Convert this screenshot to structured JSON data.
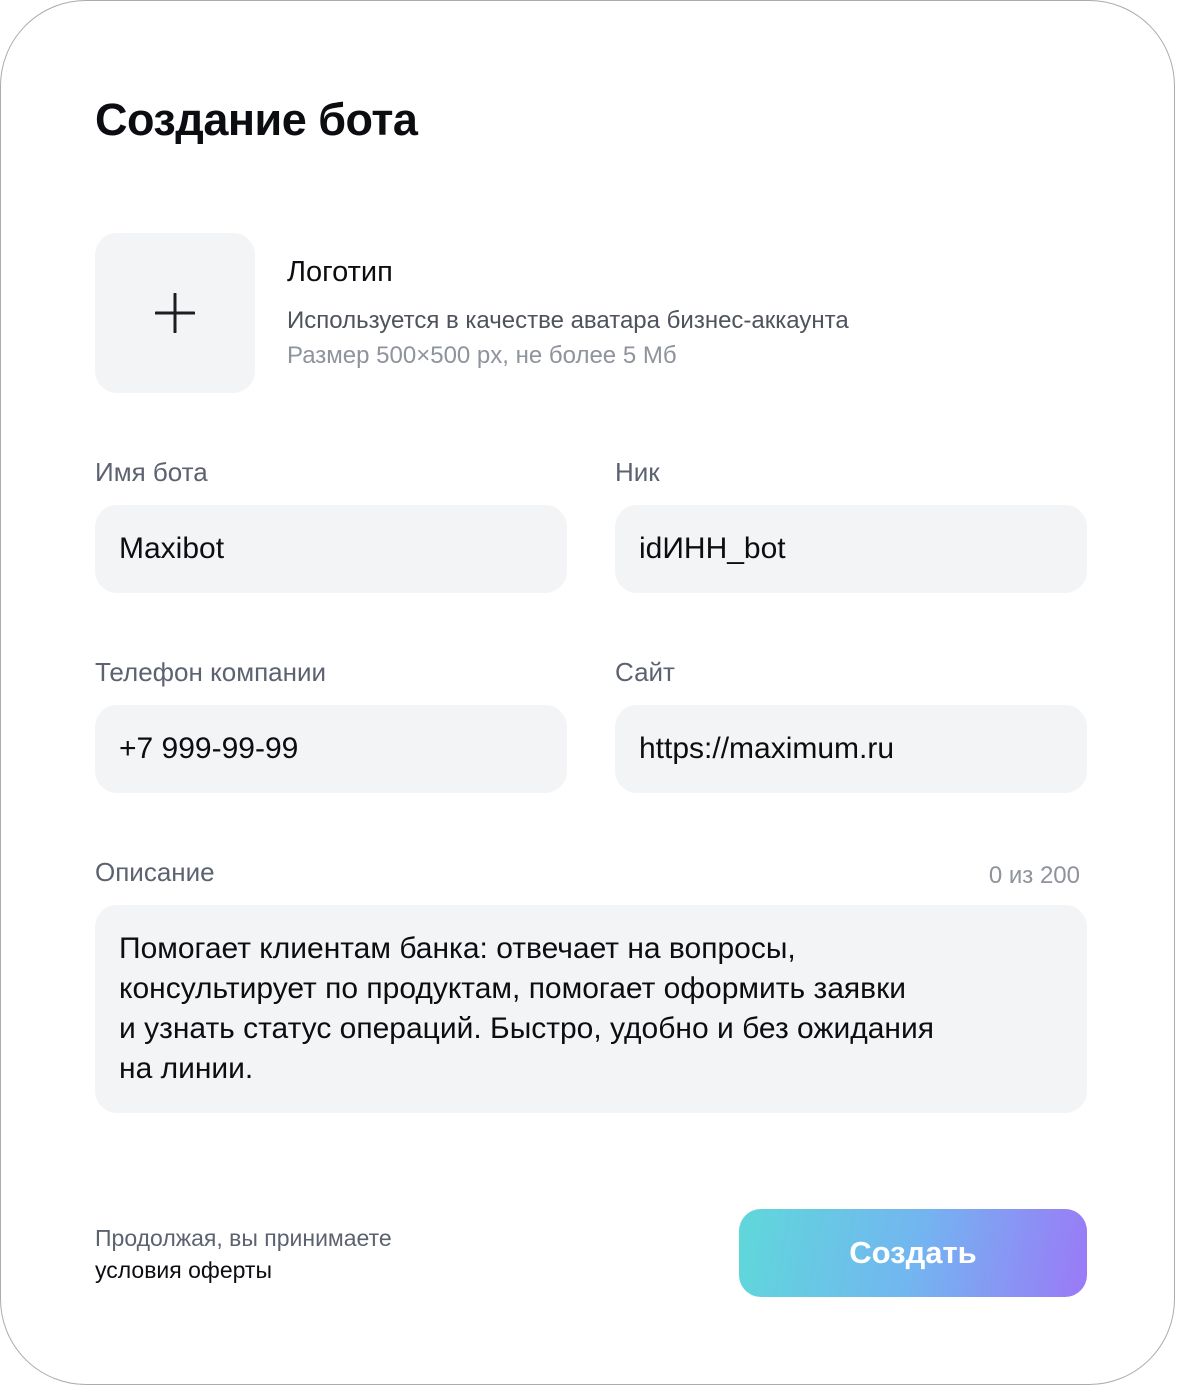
{
  "dialog": {
    "title": "Создание бота"
  },
  "logo": {
    "title": "Логотип",
    "description": "Используется в качестве аватара бизнес-аккаунта",
    "hint": "Размер 500×500 px, не более 5 Мб",
    "icon": "plus-icon"
  },
  "fields": {
    "bot_name": {
      "label": "Имя бота",
      "value": "Maxibot"
    },
    "nick": {
      "label": "Ник",
      "value": "idИНН_bot"
    },
    "phone": {
      "label": "Телефон компании",
      "value": "+7 999-99-99"
    },
    "site": {
      "label": "Сайт",
      "value": "https://maximum.ru"
    }
  },
  "description": {
    "label": "Описание",
    "counter": "0 из 200",
    "lines": [
      "Помогает клиентам банка: отвечает на вопросы,",
      "консультирует по продуктам, помогает оформить заявки",
      "и узнать статус операций. Быстро, удобно и без ожидания",
      "на линии."
    ]
  },
  "footer": {
    "terms_text": "Продолжая, вы принимаете",
    "terms_link": "условия оферты",
    "create_label": "Создать"
  },
  "colors": {
    "field_background": "#f3f4f6",
    "label": "#5c6270",
    "hint": "#8e939c",
    "button_gradient_start": "#5fd8da",
    "button_gradient_end": "#9b79f7"
  }
}
